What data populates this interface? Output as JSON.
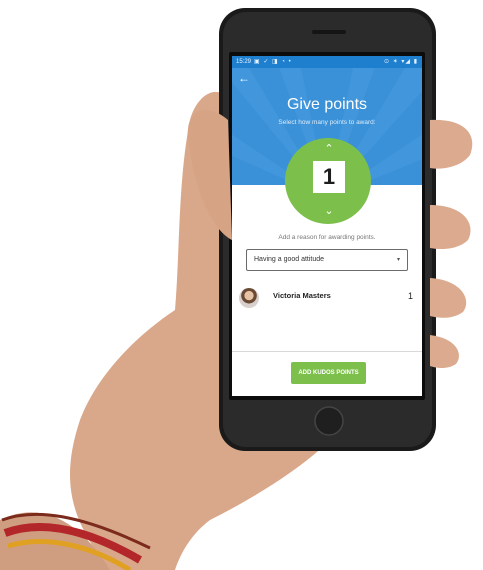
{
  "status_bar": {
    "time": "15:29",
    "icons_left": "▣ ✓ ◨ ◔ •",
    "icons_right": "⊙ ✶ ▾◢ ▮"
  },
  "header": {
    "back_icon": "←",
    "title": "Give points",
    "subtitle": "Select how many points to award:"
  },
  "counter": {
    "value": "1",
    "up_icon": "⌃",
    "down_icon": "⌄"
  },
  "reason": {
    "label": "Add a reason for awarding points.",
    "selected": "Having a good attitude",
    "caret": "▾"
  },
  "recipient": {
    "name": "Victoria Masters",
    "points": "1"
  },
  "footer": {
    "button_label": "ADD KUDOS POINTS"
  },
  "colors": {
    "header_blue": "#3a91d7",
    "status_blue": "#1f7fcf",
    "kudos_green": "#7cc04b"
  }
}
